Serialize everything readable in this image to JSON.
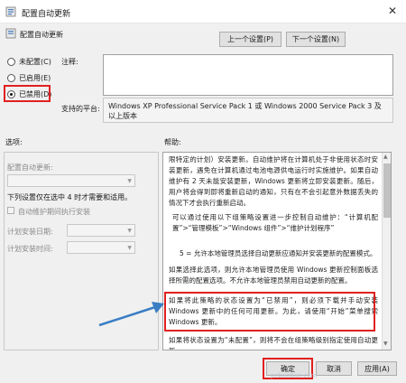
{
  "window": {
    "title": "配置自动更新",
    "heading": "配置自动更新"
  },
  "nav": {
    "prev": "上一个设置(P)",
    "next": "下一个设置(N)"
  },
  "state": {
    "not_configured": "未配置(C)",
    "enabled": "已启用(E)",
    "disabled": "已禁用(D)",
    "selected": "disabled"
  },
  "comment": {
    "label": "注释:"
  },
  "platform": {
    "label": "支持的平台:",
    "text": "Windows XP Professional Service Pack 1 或 Windows 2000 Service Pack 3 及以上版本"
  },
  "options": {
    "label": "选项:",
    "configure_label": "配置自动更新:",
    "schedule_note": "下列设置仅在选中 4 时才需要和适用。",
    "maintenance_check": "自动维护期间执行安装",
    "install_day": "计划安装日期:",
    "install_time": "计划安装时间:"
  },
  "help": {
    "label": "帮助:",
    "p1": "限特定的计划）安装更新。自动维护将在计算机处于非使用状态时安装更新，遇免在计算机通过电池电源供电运行时实施维护。如果自动维护有 2 天未能安装更新，Windows 更新将立即安装更新。随后，用户将会得到即将重新启动的通知，只有在不会引起意外数据丢失的情况下才会执行重新启动。",
    "p2": "可以通过使用以下组策略设置进一步控制自动维护：“计算机配置”>“管理模板”>“Windows 组件”>“维护计划程序”",
    "p3": "5 = 允许本地管理员选择自动更新应通知并安装更新的配置模式。",
    "p4": "如果选择此选项，则允许本地管理员使用 Windows 更新控制面板选择所需的配置选项。不允许本地管理员禁用自动更新的配置。",
    "p5": "如果将此策略的状态设置为“已禁用”，则必须下载并手动安装 Windows 更新中的任何可用更新。为此，请使用“开始”菜单搜索 Windows 更新。",
    "p6": "如果将状态设置为“未配置”，则将不会在组策略级别指定使用自动更新。"
  },
  "buttons": {
    "ok": "确定",
    "cancel": "取消",
    "apply": "应用(A)"
  },
  "watermark": "pcbaobao.com",
  "colors": {
    "highlight": "#e02020",
    "arrow": "#3a7dc4"
  }
}
